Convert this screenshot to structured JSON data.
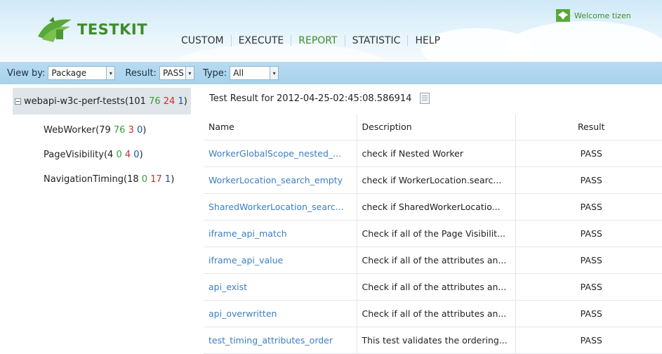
{
  "header": {
    "logo_text": "TESTKIT",
    "welcome": "Welcome tizen",
    "nav": [
      "CUSTOM",
      "EXECUTE",
      "REPORT",
      "STATISTIC",
      "HELP"
    ],
    "active_nav": "REPORT",
    "accent_color": "#3f8c2a"
  },
  "filters": {
    "view_by_label": "View by:",
    "view_by_value": "Package",
    "result_label": "Result:",
    "result_value": "PASS",
    "type_label": "Type:",
    "type_value": "All"
  },
  "tree": {
    "root": {
      "name": "webapi-w3c-perf-tests(",
      "total": "101",
      "pass": "76",
      "fail": "24",
      "block": "1",
      "close": ")"
    },
    "children": [
      {
        "name": "WebWorker(",
        "total": "79",
        "pass": "76",
        "fail": "3",
        "block": "0",
        "close": ")"
      },
      {
        "name": "PageVisibility(",
        "total": "4",
        "pass": "0",
        "fail": "4",
        "block": "0",
        "close": ")"
      },
      {
        "name": "NavigationTiming(",
        "total": "18",
        "pass": "0",
        "fail": "17",
        "block": "1",
        "close": ")"
      }
    ]
  },
  "results": {
    "title": "Test Result for  2012-04-25-02:45:08.586914",
    "columns": [
      "Name",
      "Description",
      "Result"
    ],
    "rows": [
      {
        "name": "WorkerGlobalScope_nested_...",
        "description": "check if Nested Worker",
        "result": "PASS"
      },
      {
        "name": "WorkerLocation_search_empty",
        "description": "check if WorkerLocation.searc...",
        "result": "PASS"
      },
      {
        "name": "SharedWorkerLocation_searc...",
        "description": "check if SharedWorkerLocatio...",
        "result": "PASS"
      },
      {
        "name": "iframe_api_match",
        "description": "Check if all of the Page Visibilit...",
        "result": "PASS"
      },
      {
        "name": "iframe_api_value",
        "description": "Check if all of the attributes an...",
        "result": "PASS"
      },
      {
        "name": "api_exist",
        "description": "Check if all of the attributes an...",
        "result": "PASS"
      },
      {
        "name": "api_overwritten",
        "description": "Check if all of the attributes an...",
        "result": "PASS"
      },
      {
        "name": "test_timing_attributes_order",
        "description": "This test validates the ordering...",
        "result": "PASS"
      }
    ]
  }
}
